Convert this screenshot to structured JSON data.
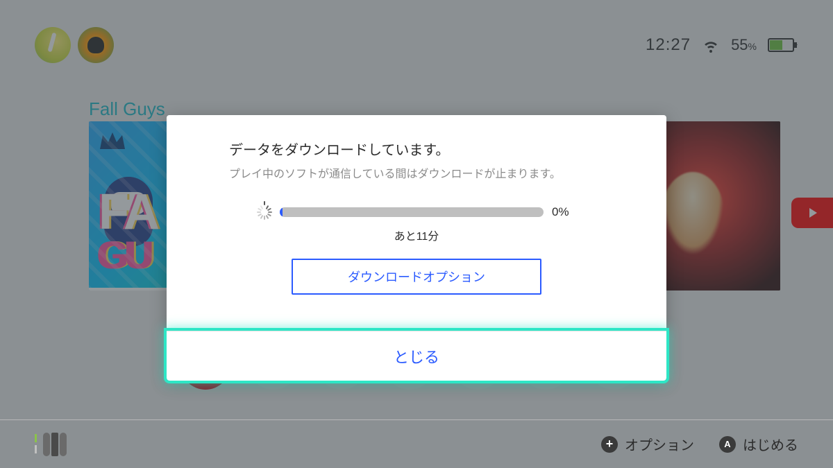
{
  "status": {
    "time": "12:27",
    "battery_pct": "55",
    "battery_pct_sym": "%"
  },
  "home": {
    "selected_game_title": "Fall Guys"
  },
  "dialog": {
    "title": "データをダウンロードしています。",
    "subtitle": "プレイ中のソフトが通信している間はダウンロードが止まります。",
    "percent": "0%",
    "eta": "あと11分",
    "options_label": "ダウンロードオプション",
    "close_label": "とじる"
  },
  "footer": {
    "options_label": "オプション",
    "start_label": "はじめる",
    "plus_glyph": "+",
    "a_glyph": "A"
  }
}
